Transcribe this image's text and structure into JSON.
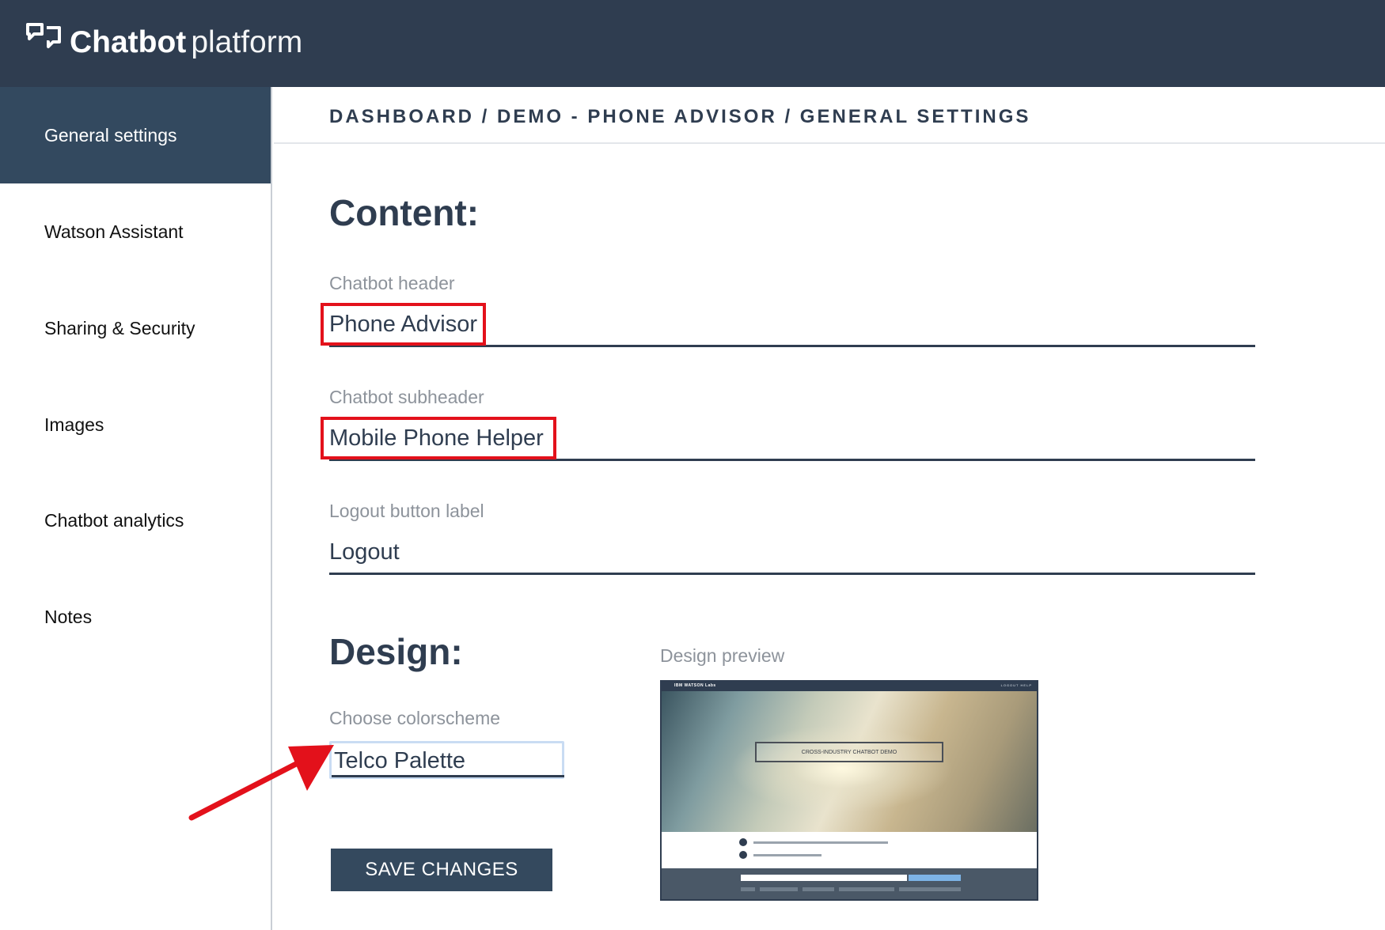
{
  "app": {
    "title_bold": "Chatbot",
    "title_light": "platform",
    "logo_icon": "chat-bubble-icon"
  },
  "sidebar": {
    "items": [
      {
        "label": "General settings",
        "active": true
      },
      {
        "label": "Watson Assistant",
        "active": false
      },
      {
        "label": "Sharing & Security",
        "active": false
      },
      {
        "label": "Images",
        "active": false
      },
      {
        "label": "Chatbot analytics",
        "active": false
      },
      {
        "label": "Notes",
        "active": false
      }
    ]
  },
  "breadcrumb": "DASHBOARD / DEMO - PHONE ADVISOR / GENERAL SETTINGS",
  "content": {
    "title": "Content:",
    "fields": [
      {
        "label": "Chatbot header",
        "value": "Phone Advisor"
      },
      {
        "label": "Chatbot subheader",
        "value": "Mobile Phone Helper"
      },
      {
        "label": "Logout button label",
        "value": "Logout"
      }
    ]
  },
  "design": {
    "title": "Design:",
    "colorscheme_label": "Choose colorscheme",
    "colorscheme_value": "Telco Palette",
    "save_label": "SAVE CHANGES",
    "preview_label": "Design preview",
    "preview": {
      "brand": "IBM WATSON Labs",
      "links": "LOGOUT   HELP",
      "hero_title": "CROSS-INDUSTRY CHATBOT DEMO"
    }
  },
  "colors": {
    "topbar": "#2f3d50",
    "sidebar_active": "#33495f",
    "annotation": "#e3111b",
    "button": "#34495e"
  }
}
